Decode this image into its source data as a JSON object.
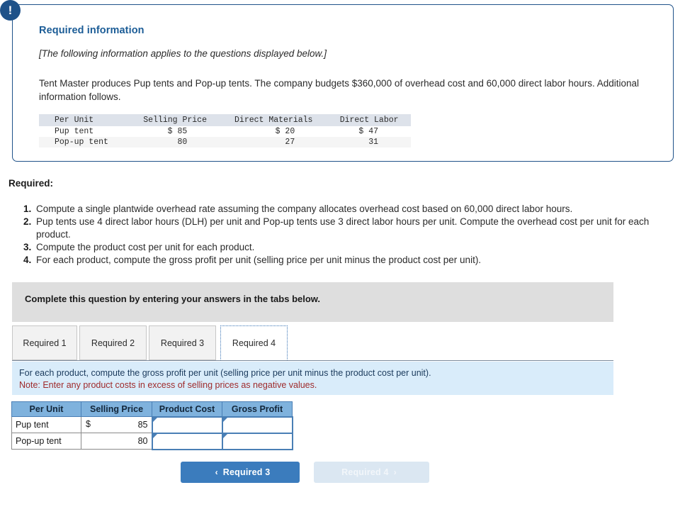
{
  "info_panel": {
    "badge_icon": "exclamation-icon",
    "badge_glyph": "!",
    "title": "Required information",
    "italic_note": "[The following information applies to the questions displayed below.]",
    "body": "Tent Master produces Pup tents and Pop-up tents. The company budgets $360,000 of overhead cost and 60,000 direct labor hours. Additional information follows.",
    "table": {
      "headers": [
        "Per Unit",
        "Selling Price",
        "Direct Materials",
        "Direct Labor"
      ],
      "rows": [
        {
          "label": "Pup tent",
          "selling_price": "$ 85",
          "direct_materials": "$ 20",
          "direct_labor": "$ 47"
        },
        {
          "label": "Pop-up tent",
          "selling_price": "80",
          "direct_materials": "27",
          "direct_labor": "31"
        }
      ]
    }
  },
  "required": {
    "heading": "Required:",
    "items": [
      "Compute a single plantwide overhead rate assuming the company allocates overhead cost based on 60,000 direct labor hours.",
      "Pup tents use 4 direct labor hours (DLH) per unit and Pop-up tents use 3 direct labor hours per unit. Compute the overhead cost per unit for each product.",
      "Compute the product cost per unit for each product.",
      "For each product, compute the gross profit per unit (selling price per unit minus the product cost per unit)."
    ]
  },
  "complete_bar": {
    "text": "Complete this question by entering your answers in the tabs below."
  },
  "tabs": [
    {
      "label": "Required 1",
      "active": false
    },
    {
      "label": "Required 2",
      "active": false
    },
    {
      "label": "Required 3",
      "active": false
    },
    {
      "label": "Required 4",
      "active": true
    }
  ],
  "instruction": {
    "line1": "For each product, compute the gross profit per unit (selling price per unit minus the product cost per unit).",
    "line2": "Note: Enter any product costs in excess of selling prices as negative values."
  },
  "answer_table": {
    "headers": [
      "Per Unit",
      "Selling Price",
      "Product Cost",
      "Gross Profit"
    ],
    "rows": [
      {
        "label": "Pup tent",
        "selling_currency": "$",
        "selling_price": "85",
        "product_cost": "",
        "gross_profit": ""
      },
      {
        "label": "Pop-up tent",
        "selling_currency": "",
        "selling_price": "80",
        "product_cost": "",
        "gross_profit": ""
      }
    ]
  },
  "nav": {
    "prev_label": "Required 3",
    "prev_icon": "chevron-left-icon",
    "prev_glyph": "‹",
    "next_label": "Required 4",
    "next_icon": "chevron-right-icon",
    "next_glyph": "›"
  },
  "colors": {
    "panel_border": "#1f5289",
    "badge_bg": "#1f5289",
    "title_blue": "#1b5c96",
    "instruction_bg": "#d9ecfa",
    "note_red": "#9e2a2b",
    "table_header_blue": "#7fb2dd",
    "active_button_blue": "#3b7cbd",
    "disabled_button_blue": "#dbe7f2",
    "grey_bar": "#dedede"
  }
}
